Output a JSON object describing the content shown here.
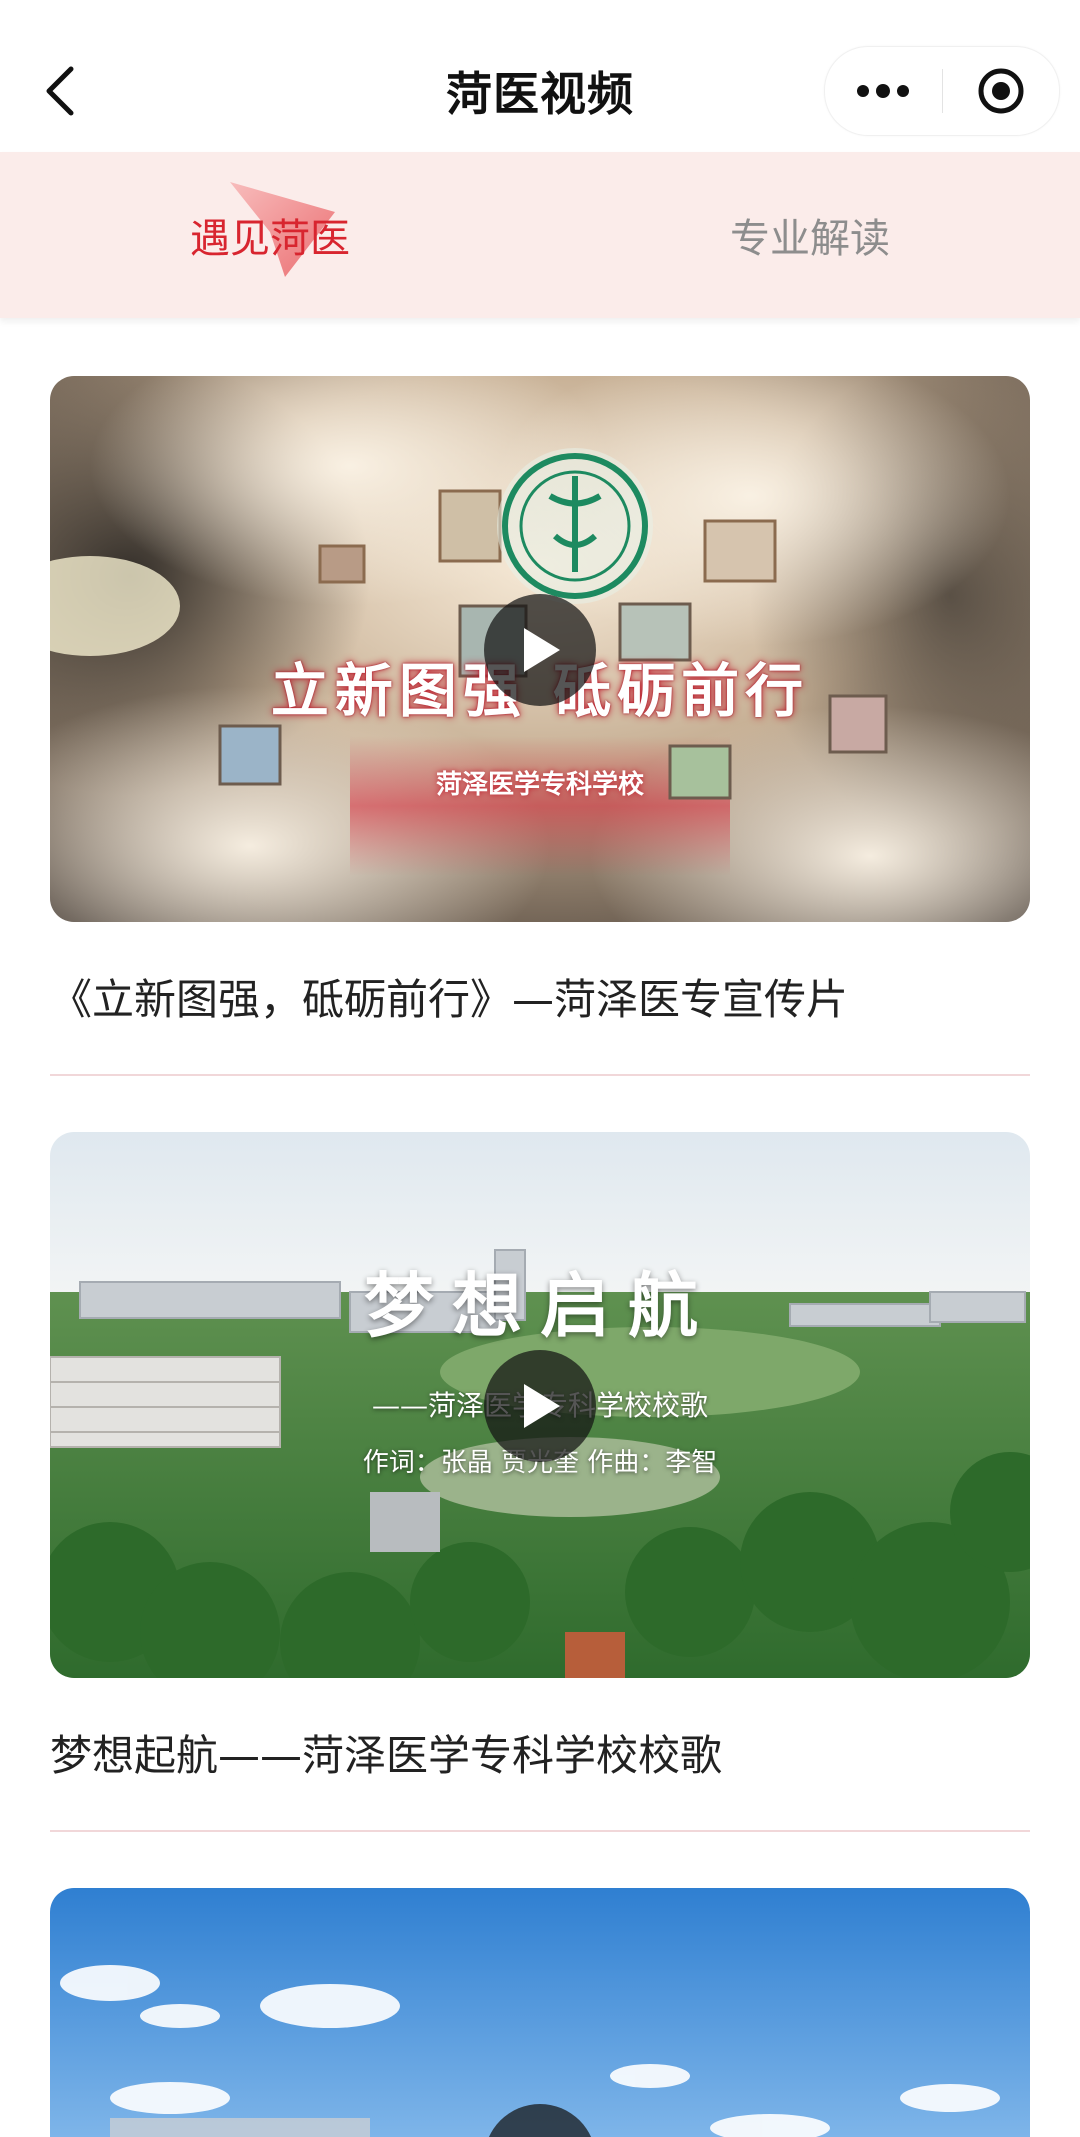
{
  "header": {
    "title": "菏医视频",
    "back_icon": "chevron-left-icon",
    "more_icon": "more-dots-icon",
    "target_icon": "target-icon"
  },
  "tabs": [
    {
      "label": "遇见菏医",
      "active": true
    },
    {
      "label": "专业解读",
      "active": false
    }
  ],
  "colors": {
    "accent": "#d8252f",
    "tab_bar_bg": "#fbecea",
    "inactive_tab": "#8d8d8d",
    "separator": "#f1d7d9"
  },
  "videos": [
    {
      "caption": "《立新图强，砥砺前行》—菏泽医专宣传片",
      "overlay_title": "立新图强 砥砺前行",
      "overlay_subtitle": "菏泽医学专科学校"
    },
    {
      "caption": "梦想起航——菏泽医学专科学校校歌",
      "overlay_title": "梦想启航",
      "overlay_subtitle": "——菏泽医学专科学校校歌",
      "overlay_credits": "作词：张晶 贾光奎    作曲：李智"
    },
    {
      "caption": ""
    }
  ]
}
